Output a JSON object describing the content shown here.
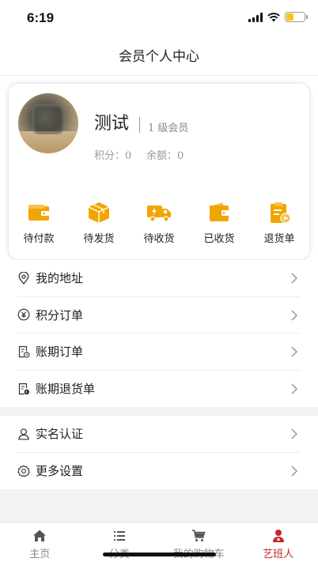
{
  "status_bar": {
    "time": "6:19"
  },
  "header": {
    "title": "会员个人中心"
  },
  "profile": {
    "username": "测试",
    "level": "1 级会员",
    "points": "积分：0",
    "balance": "余额：0"
  },
  "order_shortcuts": [
    {
      "label": "待付款",
      "icon": "wallet-icon"
    },
    {
      "label": "待发货",
      "icon": "package-icon"
    },
    {
      "label": "待收货",
      "icon": "truck-icon"
    },
    {
      "label": "已收货",
      "icon": "received-wallet-icon"
    },
    {
      "label": "退货单",
      "icon": "return-clipboard-icon"
    }
  ],
  "menu_group_1": [
    {
      "label": "我的地址",
      "icon": "location-pin-icon"
    },
    {
      "label": "积分订单",
      "icon": "yuan-coin-icon"
    },
    {
      "label": "账期订单",
      "icon": "document-clock-icon"
    },
    {
      "label": "账期退货单",
      "icon": "document-return-icon"
    }
  ],
  "menu_group_2": [
    {
      "label": "实名认证",
      "icon": "user-icon"
    },
    {
      "label": "更多设置",
      "icon": "gear-icon"
    }
  ],
  "tabbar": [
    {
      "label": "主页",
      "icon": "home-icon",
      "active": false
    },
    {
      "label": "分类",
      "icon": "list-icon",
      "active": false
    },
    {
      "label": "我的购物车",
      "icon": "cart-icon",
      "active": false
    },
    {
      "label": "艺班人",
      "icon": "profile-icon",
      "active": true
    }
  ],
  "colors": {
    "accent": "#c62828",
    "icon_orange": "#f0a500"
  }
}
